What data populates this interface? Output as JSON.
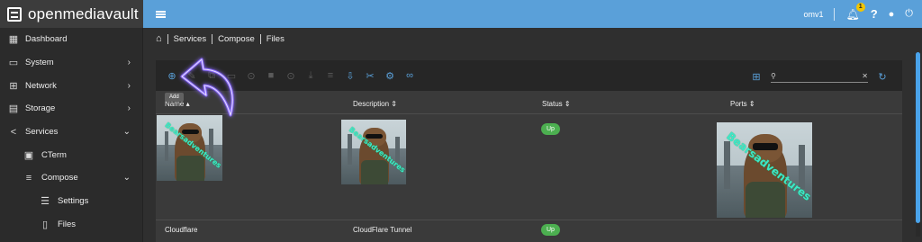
{
  "brand": {
    "name": "openmediavault"
  },
  "sidebar": {
    "items": [
      {
        "label": "Dashboard",
        "icon": "grid-icon",
        "level": 0,
        "chevron": ""
      },
      {
        "label": "System",
        "icon": "laptop-icon",
        "level": 0,
        "chevron": "›"
      },
      {
        "label": "Network",
        "icon": "network-icon",
        "level": 0,
        "chevron": "›"
      },
      {
        "label": "Storage",
        "icon": "storage-icon",
        "level": 0,
        "chevron": "›"
      },
      {
        "label": "Services",
        "icon": "share-icon",
        "level": 0,
        "chevron": "⌄"
      },
      {
        "label": "CTerm",
        "icon": "terminal-icon",
        "level": 1,
        "chevron": ""
      },
      {
        "label": "Compose",
        "icon": "compose-icon",
        "level": 1,
        "chevron": "⌄"
      },
      {
        "label": "Settings",
        "icon": "sliders-icon",
        "level": 2,
        "chevron": ""
      },
      {
        "label": "Files",
        "icon": "file-icon",
        "level": 2,
        "chevron": ""
      }
    ]
  },
  "topbar": {
    "hostname": "omv1",
    "notification_count": "1"
  },
  "breadcrumb": {
    "items": [
      "Services",
      "Compose",
      "Files"
    ]
  },
  "toolbar": {
    "tooltip": "Add",
    "search_placeholder": ""
  },
  "table": {
    "columns": [
      "Name",
      "Description",
      "Status",
      "Ports"
    ],
    "name_sort": "▴",
    "other_sort": "⇕",
    "rows": [
      {
        "name": "",
        "description": "",
        "status": "Up",
        "ports": ""
      },
      {
        "name": "Cloudflare",
        "description": "CloudFlare Tunnel",
        "status": "Up",
        "ports": ""
      }
    ]
  },
  "watermark": "Bearsadventures",
  "colors": {
    "accent": "#5aa0d9",
    "status_up": "#4caf50",
    "arrow": "#8a6bff"
  }
}
